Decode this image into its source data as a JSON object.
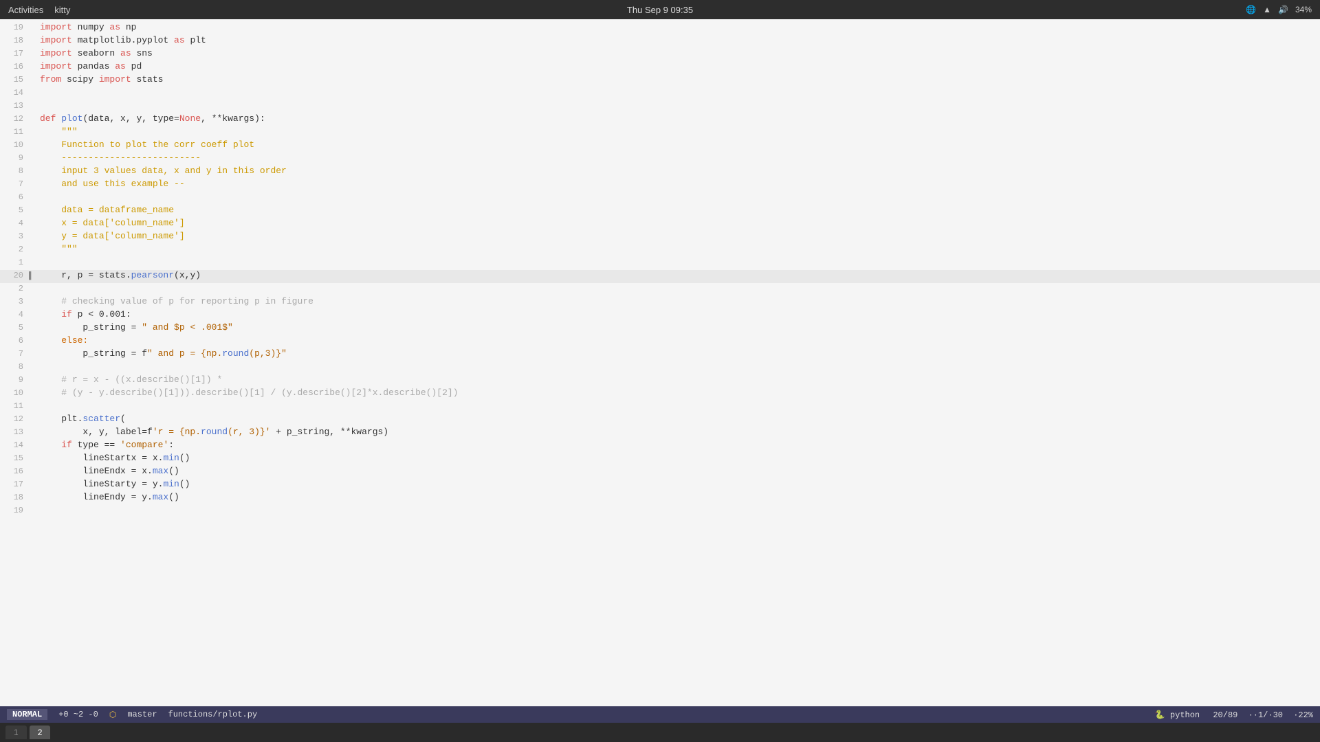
{
  "topbar": {
    "activities": "Activities",
    "terminal": "kitty",
    "datetime": "Thu Sep 9  09:35",
    "battery": "34%"
  },
  "statusbar": {
    "mode": "NORMAL",
    "git_status": "+0 ~2 -0",
    "branch_icon": "⬡",
    "branch": "master",
    "file": "functions/rplot.py",
    "lang_icon": "🐍",
    "lang": "python",
    "position": "20/89",
    "cursor": "··1/·30",
    "scroll": "·22%"
  },
  "tabs": [
    {
      "label": "1",
      "active": false
    },
    {
      "label": "2",
      "active": true
    }
  ],
  "lines": [
    {
      "num": "19",
      "indent": "",
      "content": [
        {
          "t": "import",
          "c": "kw"
        },
        {
          "t": " numpy ",
          "c": "plain"
        },
        {
          "t": "as",
          "c": "kw"
        },
        {
          "t": " np",
          "c": "plain"
        }
      ],
      "highlighted": false
    },
    {
      "num": "18",
      "indent": "",
      "content": [
        {
          "t": "import",
          "c": "kw"
        },
        {
          "t": " matplotlib.pyplot ",
          "c": "plain"
        },
        {
          "t": "as",
          "c": "kw"
        },
        {
          "t": " plt",
          "c": "plain"
        }
      ],
      "highlighted": false
    },
    {
      "num": "17",
      "indent": "",
      "content": [
        {
          "t": "import",
          "c": "kw"
        },
        {
          "t": " seaborn ",
          "c": "plain"
        },
        {
          "t": "as",
          "c": "kw"
        },
        {
          "t": " sns",
          "c": "plain"
        }
      ],
      "highlighted": false
    },
    {
      "num": "16",
      "indent": "",
      "content": [
        {
          "t": "import",
          "c": "kw"
        },
        {
          "t": " pandas ",
          "c": "plain"
        },
        {
          "t": "as",
          "c": "kw"
        },
        {
          "t": " pd",
          "c": "plain"
        }
      ],
      "highlighted": false
    },
    {
      "num": "15",
      "indent": "",
      "content": [
        {
          "t": "from",
          "c": "kw"
        },
        {
          "t": " scipy ",
          "c": "plain"
        },
        {
          "t": "import",
          "c": "kw"
        },
        {
          "t": " stats",
          "c": "plain"
        }
      ],
      "highlighted": false
    },
    {
      "num": "14",
      "indent": "",
      "content": [],
      "highlighted": false
    },
    {
      "num": "13",
      "indent": "",
      "content": [],
      "highlighted": false
    },
    {
      "num": "12",
      "indent": "",
      "content": [
        {
          "t": "def",
          "c": "kw"
        },
        {
          "t": " ",
          "c": "plain"
        },
        {
          "t": "plot",
          "c": "fn"
        },
        {
          "t": "(data, x, y, type=",
          "c": "plain"
        },
        {
          "t": "None",
          "c": "kw"
        },
        {
          "t": ", **kwargs):",
          "c": "plain"
        }
      ],
      "highlighted": false
    },
    {
      "num": "11",
      "indent": "    ",
      "content": [
        {
          "t": "    ",
          "c": "plain"
        },
        {
          "t": "\"\"\"",
          "c": "docstr"
        }
      ],
      "highlighted": false
    },
    {
      "num": "10",
      "indent": "    ",
      "content": [
        {
          "t": "    Function to plot the corr coeff plot",
          "c": "docstr"
        }
      ],
      "highlighted": false
    },
    {
      "num": "9",
      "indent": "    ",
      "content": [
        {
          "t": "    --------------------------",
          "c": "docstr"
        }
      ],
      "highlighted": false
    },
    {
      "num": "8",
      "indent": "    ",
      "content": [
        {
          "t": "    input 3 values data, x and y in this order",
          "c": "docstr"
        }
      ],
      "highlighted": false
    },
    {
      "num": "7",
      "indent": "    ",
      "content": [
        {
          "t": "    and use this example --",
          "c": "docstr"
        }
      ],
      "highlighted": false
    },
    {
      "num": "6",
      "indent": "    ",
      "content": [],
      "highlighted": false
    },
    {
      "num": "5",
      "indent": "    ",
      "content": [
        {
          "t": "    data = dataframe_name",
          "c": "docstr"
        }
      ],
      "highlighted": false
    },
    {
      "num": "4",
      "indent": "    ",
      "content": [
        {
          "t": "    x = data[",
          "c": "docstr"
        },
        {
          "t": "'column_name'",
          "c": "docstr"
        },
        {
          "t": "]",
          "c": "docstr"
        }
      ],
      "highlighted": false
    },
    {
      "num": "3",
      "indent": "    ",
      "content": [
        {
          "t": "    y = data[",
          "c": "docstr"
        },
        {
          "t": "'column_name'",
          "c": "docstr"
        },
        {
          "t": "]",
          "c": "docstr"
        }
      ],
      "highlighted": false
    },
    {
      "num": "2",
      "indent": "    ",
      "content": [
        {
          "t": "    \"\"\"",
          "c": "docstr"
        }
      ],
      "highlighted": false
    },
    {
      "num": "1",
      "indent": "",
      "content": [],
      "highlighted": false
    },
    {
      "num": "20",
      "indent": "    ",
      "content": [
        {
          "t": "    r, p = stats.",
          "c": "plain"
        },
        {
          "t": "pearsonr",
          "c": "method"
        },
        {
          "t": "(x,y)",
          "c": "plain"
        }
      ],
      "highlighted": true
    },
    {
      "num": "2",
      "indent": "",
      "content": [],
      "highlighted": false
    },
    {
      "num": "3",
      "indent": "    ",
      "content": [
        {
          "t": "    ",
          "c": "plain"
        },
        {
          "t": "# checking value of p for reporting p in figure",
          "c": "comment"
        }
      ],
      "highlighted": false
    },
    {
      "num": "4",
      "indent": "    ",
      "content": [
        {
          "t": "    ",
          "c": "plain"
        },
        {
          "t": "if",
          "c": "kw"
        },
        {
          "t": " p < 0.001:",
          "c": "plain"
        }
      ],
      "highlighted": false
    },
    {
      "num": "5",
      "indent": "        ",
      "content": [
        {
          "t": "        p_string = ",
          "c": "plain"
        },
        {
          "t": "\" and $p < .001$\"",
          "c": "str"
        }
      ],
      "highlighted": false
    },
    {
      "num": "6",
      "indent": "    ",
      "content": [
        {
          "t": "    ",
          "c": "plain"
        },
        {
          "t": "else:",
          "c": "kw2"
        }
      ],
      "highlighted": false
    },
    {
      "num": "7",
      "indent": "        ",
      "content": [
        {
          "t": "        p_string = f",
          "c": "plain"
        },
        {
          "t": "\" and p = {np.",
          "c": "str"
        },
        {
          "t": "round",
          "c": "method"
        },
        {
          "t": "(p,3)}\"",
          "c": "str"
        }
      ],
      "highlighted": false
    },
    {
      "num": "8",
      "indent": "",
      "content": [],
      "highlighted": false
    },
    {
      "num": "9",
      "indent": "    ",
      "content": [
        {
          "t": "    ",
          "c": "plain"
        },
        {
          "t": "# r = x - ((x.describe()[1]) *",
          "c": "comment"
        }
      ],
      "highlighted": false
    },
    {
      "num": "10",
      "indent": "    ",
      "content": [
        {
          "t": "    ",
          "c": "plain"
        },
        {
          "t": "# (y - y.describe()[1])).describe()[1] / (y.describe()[2]*x.describe()[2])",
          "c": "comment"
        }
      ],
      "highlighted": false
    },
    {
      "num": "11",
      "indent": "",
      "content": [],
      "highlighted": false
    },
    {
      "num": "12",
      "indent": "    ",
      "content": [
        {
          "t": "    plt.",
          "c": "plain"
        },
        {
          "t": "scatter",
          "c": "method"
        },
        {
          "t": "(",
          "c": "plain"
        }
      ],
      "highlighted": false
    },
    {
      "num": "13",
      "indent": "        ",
      "content": [
        {
          "t": "        x, y, label=f",
          "c": "plain"
        },
        {
          "t": "'r = {np.",
          "c": "str"
        },
        {
          "t": "round",
          "c": "method"
        },
        {
          "t": "(r, 3)}'",
          "c": "str"
        },
        {
          "t": " + p_string, **kwargs)",
          "c": "plain"
        }
      ],
      "highlighted": false
    },
    {
      "num": "14",
      "indent": "    ",
      "content": [
        {
          "t": "    ",
          "c": "plain"
        },
        {
          "t": "if",
          "c": "kw"
        },
        {
          "t": " type == ",
          "c": "plain"
        },
        {
          "t": "'compare'",
          "c": "str"
        },
        {
          "t": ":",
          "c": "plain"
        }
      ],
      "highlighted": false
    },
    {
      "num": "15",
      "indent": "        ",
      "content": [
        {
          "t": "        lineStartx = x.",
          "c": "plain"
        },
        {
          "t": "min",
          "c": "method"
        },
        {
          "t": "()",
          "c": "plain"
        }
      ],
      "highlighted": false
    },
    {
      "num": "16",
      "indent": "        ",
      "content": [
        {
          "t": "        lineEndx = x.",
          "c": "plain"
        },
        {
          "t": "max",
          "c": "method"
        },
        {
          "t": "()",
          "c": "plain"
        }
      ],
      "highlighted": false
    },
    {
      "num": "17",
      "indent": "        ",
      "content": [
        {
          "t": "        lineStarty = y.",
          "c": "plain"
        },
        {
          "t": "min",
          "c": "method"
        },
        {
          "t": "()",
          "c": "plain"
        }
      ],
      "highlighted": false
    },
    {
      "num": "18",
      "indent": "        ",
      "content": [
        {
          "t": "        lineEndy = y.",
          "c": "plain"
        },
        {
          "t": "max",
          "c": "method"
        },
        {
          "t": "()",
          "c": "plain"
        }
      ],
      "highlighted": false
    },
    {
      "num": "19",
      "indent": "",
      "content": [],
      "highlighted": false
    }
  ]
}
